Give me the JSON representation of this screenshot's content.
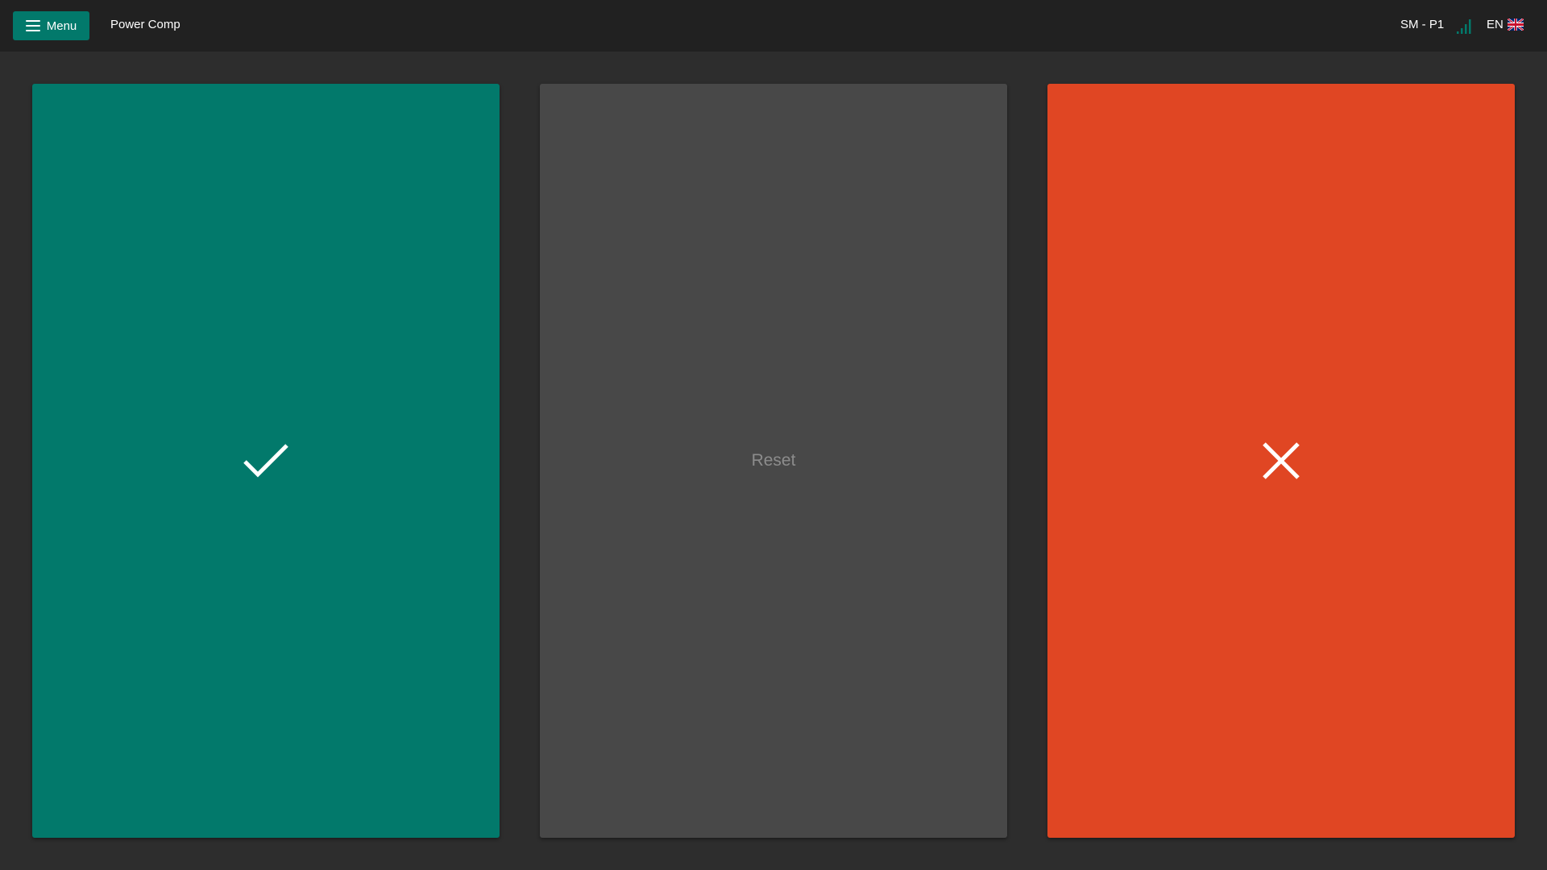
{
  "topbar": {
    "menu_label": "Menu",
    "menu_icon": "hamburger-icon",
    "app_title": "Power Comp",
    "station": "SM - P1",
    "signal_icon": "signal-strength-icon",
    "language": "EN",
    "flag_icon": "uk-flag-icon"
  },
  "panels": {
    "accept": {
      "icon": "checkmark-icon",
      "color": "#02796b"
    },
    "reset": {
      "label": "Reset",
      "color": "#484848"
    },
    "reject": {
      "icon": "close-icon",
      "color": "#e04623"
    }
  },
  "colors": {
    "background": "#2d2d2d",
    "topbar": "#212121",
    "accent": "#02796b"
  }
}
